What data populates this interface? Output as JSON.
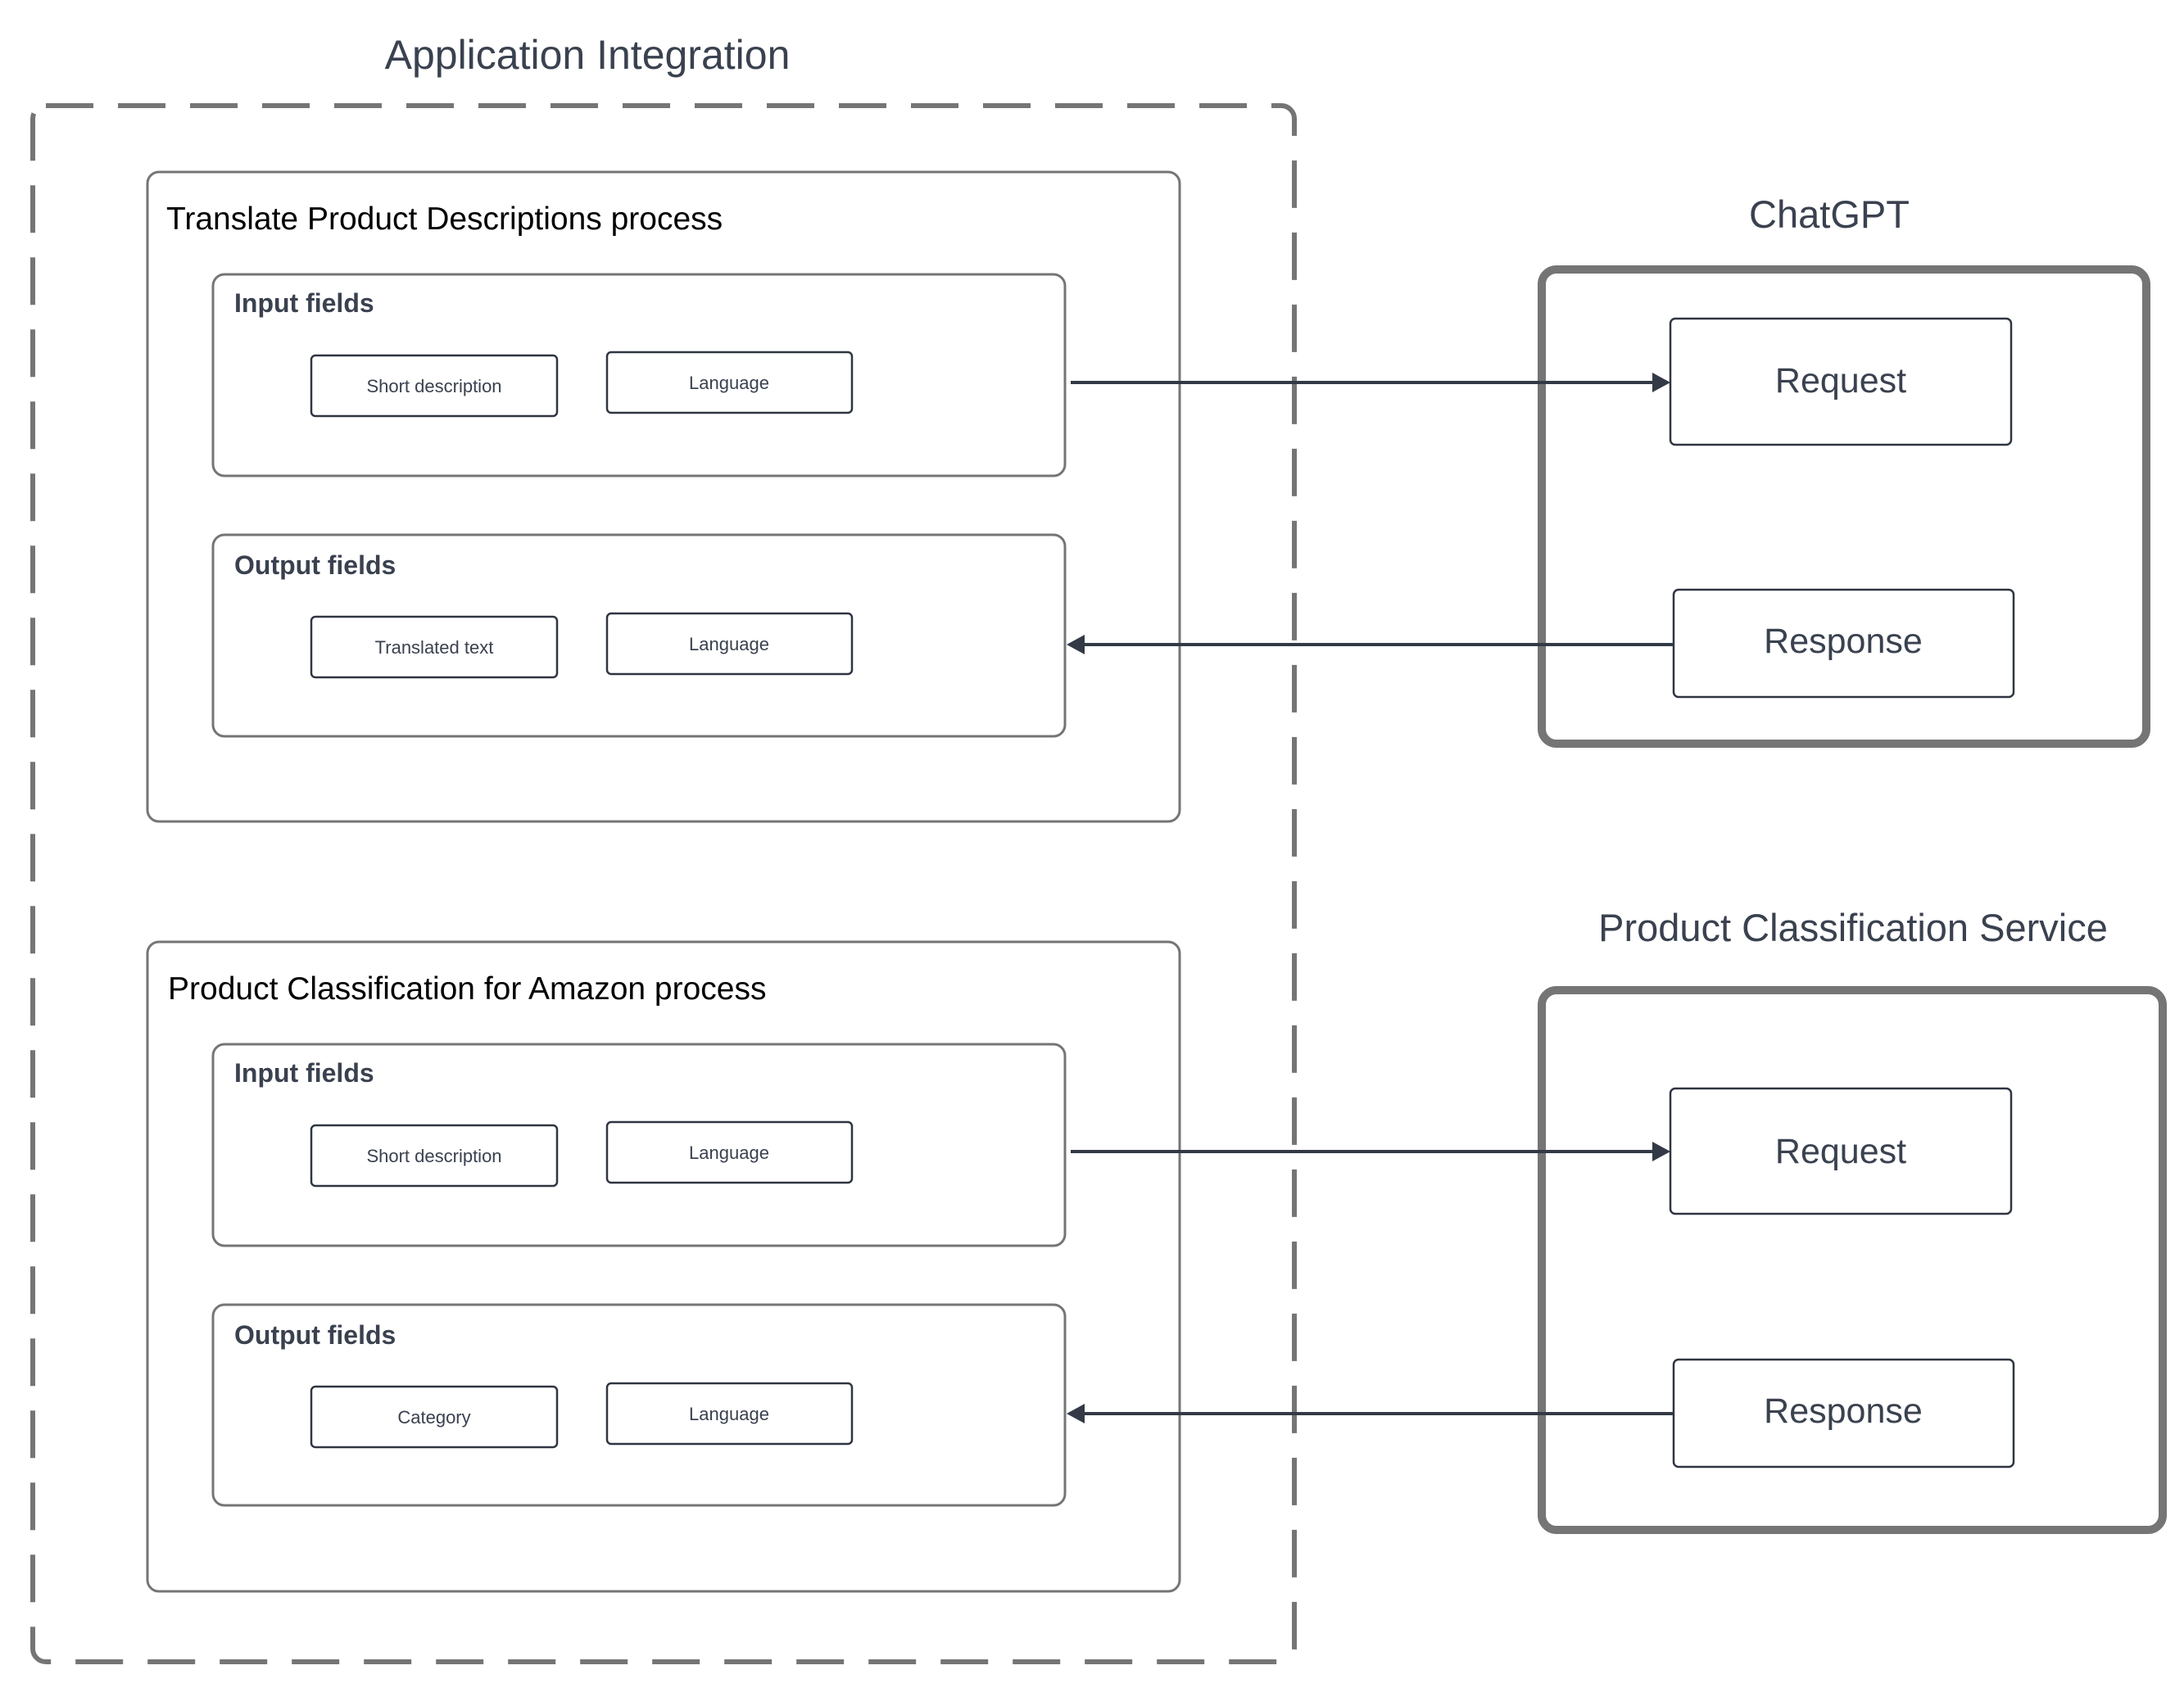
{
  "app_integration": {
    "title": "Application Integration",
    "processes": [
      {
        "title": "Translate Product Descriptions process",
        "input": {
          "label": "Input fields",
          "fields": [
            "Short description",
            "Language"
          ]
        },
        "output": {
          "label": "Output fields",
          "fields": [
            "Translated text",
            "Language"
          ]
        }
      },
      {
        "title": "Product Classification for Amazon process",
        "input": {
          "label": "Input fields",
          "fields": [
            "Short description",
            "Language"
          ]
        },
        "output": {
          "label": "Output fields",
          "fields": [
            "Category",
            "Language"
          ]
        }
      }
    ]
  },
  "services": [
    {
      "title": "ChatGPT",
      "request_label": "Request",
      "response_label": "Response"
    },
    {
      "title": "Product Classification Service",
      "request_label": "Request",
      "response_label": "Response"
    }
  ],
  "connections": [
    {
      "from": "Translate Product Descriptions process / Input fields",
      "to": "ChatGPT / Request",
      "direction": "right"
    },
    {
      "from": "ChatGPT / Response",
      "to": "Translate Product Descriptions process / Output fields",
      "direction": "left"
    },
    {
      "from": "Product Classification for Amazon process / Input fields",
      "to": "Product Classification Service / Request",
      "direction": "right"
    },
    {
      "from": "Product Classification Service / Response",
      "to": "Product Classification for Amazon process / Output fields",
      "direction": "left"
    }
  ],
  "colors": {
    "frame_stroke": "#757575",
    "text_dark": "#3a414f",
    "connector": "#333a46"
  }
}
